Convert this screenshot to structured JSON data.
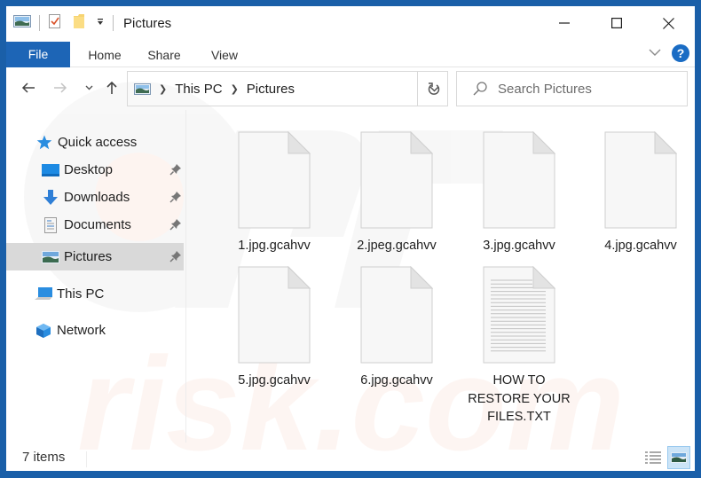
{
  "window": {
    "title": "Pictures",
    "controls": {
      "minimize": "minimize",
      "maximize": "maximize",
      "close": "close"
    }
  },
  "quick_access_toolbar": {
    "icons": [
      "pictures-folder-icon",
      "properties-icon",
      "new-folder-icon",
      "customize-dropdown-icon"
    ]
  },
  "ribbon": {
    "tabs": [
      {
        "label": "File",
        "active": true
      },
      {
        "label": "Home"
      },
      {
        "label": "Share"
      },
      {
        "label": "View"
      }
    ],
    "help_label": "?"
  },
  "navigation": {
    "breadcrumb": [
      "This PC",
      "Pictures"
    ],
    "search_placeholder": "Search Pictures"
  },
  "sidebar": {
    "items": [
      {
        "label": "Quick access",
        "icon": "star-icon",
        "pinned": false
      },
      {
        "label": "Desktop",
        "icon": "desktop-icon",
        "pinned": true
      },
      {
        "label": "Downloads",
        "icon": "download-icon",
        "pinned": true
      },
      {
        "label": "Documents",
        "icon": "documents-icon",
        "pinned": true
      },
      {
        "label": "Pictures",
        "icon": "pictures-icon",
        "pinned": true,
        "selected": true
      },
      {
        "label": "This PC",
        "icon": "computer-icon",
        "pinned": false
      },
      {
        "label": "Network",
        "icon": "network-icon",
        "pinned": false
      }
    ]
  },
  "files": [
    {
      "name": "1.jpg.gcahvv",
      "type": "blank"
    },
    {
      "name": "2.jpeg.gcahvv",
      "type": "blank"
    },
    {
      "name": "3.jpg.gcahvv",
      "type": "blank"
    },
    {
      "name": "4.jpg.gcahvv",
      "type": "blank"
    },
    {
      "name": "5.jpg.gcahvv",
      "type": "blank"
    },
    {
      "name": "6.jpg.gcahvv",
      "type": "blank"
    },
    {
      "name": "HOW TO RESTORE YOUR FILES.TXT",
      "type": "text"
    }
  ],
  "status": {
    "item_count": "7 items",
    "views": [
      "details-view",
      "large-icons-view"
    ],
    "active_view": "large-icons-view"
  },
  "watermark": {
    "text": "risk.com"
  },
  "colors": {
    "accent": "#1d65b6",
    "window_border": "#1a5fa8",
    "selected_bg": "#d9d9d9",
    "view_active_bg": "#cce4f7"
  }
}
